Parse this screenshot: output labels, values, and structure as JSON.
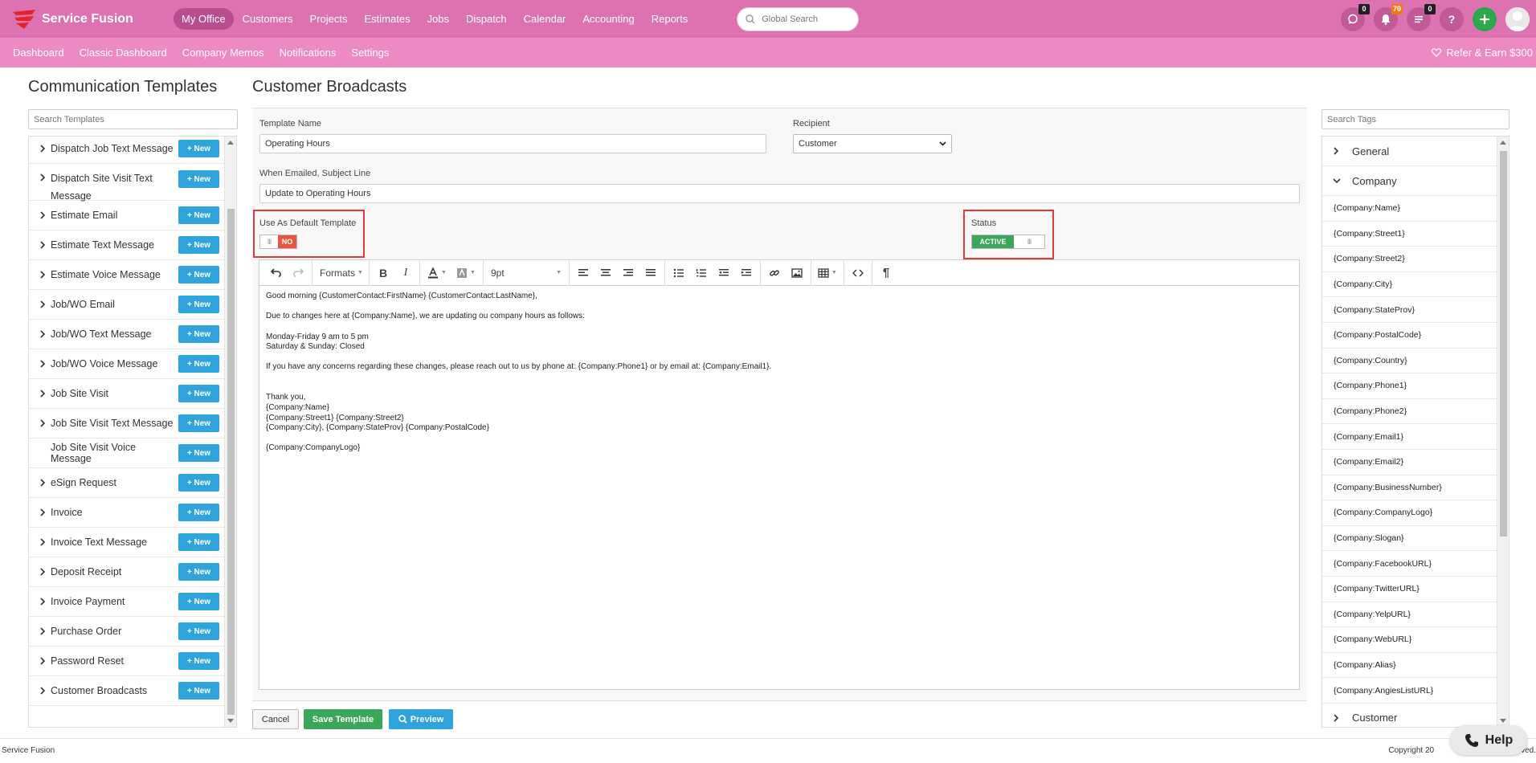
{
  "app": {
    "name": "Service Fusion",
    "brand_color": "#dc73b0",
    "subnav_color": "#ee8ac3"
  },
  "topnav": {
    "items": [
      "My Office",
      "Customers",
      "Projects",
      "Estimates",
      "Jobs",
      "Dispatch",
      "Calendar",
      "Accounting",
      "Reports"
    ],
    "active": "My Office",
    "search_placeholder": "Global Search",
    "badges": {
      "chat": "0",
      "notifications": "70",
      "tasks": "0"
    },
    "icons": [
      "chat-icon",
      "bell-icon",
      "list-icon",
      "help-icon",
      "plus-icon",
      "avatar"
    ]
  },
  "subnav": {
    "items": [
      "Dashboard",
      "Classic Dashboard",
      "Company Memos",
      "Notifications",
      "Settings"
    ],
    "refer": "Refer & Earn $300"
  },
  "left": {
    "title": "Communication Templates",
    "search_placeholder": "Search Templates",
    "new_label": "+ New",
    "items": [
      "Dispatch Job Text Message",
      "Dispatch Site Visit Text Message",
      "Estimate Email",
      "Estimate Text Message",
      "Estimate Voice Message",
      "Job/WO Email",
      "Job/WO Text Message",
      "Job/WO Voice Message",
      "Job Site Visit",
      "Job Site Visit Text Message",
      "Job Site Visit Voice Message",
      "eSign Request",
      "Invoice",
      "Invoice Text Message",
      "Deposit Receipt",
      "Invoice Payment",
      "Purchase Order",
      "Password Reset",
      "Customer Broadcasts"
    ]
  },
  "form": {
    "title": "Customer Broadcasts",
    "template_name_label": "Template Name",
    "template_name_value": "Operating Hours",
    "recipient_label": "Recipient",
    "recipient_value": "Customer",
    "subject_label": "When Emailed, Subject Line",
    "subject_value": "Update to Operating Hours",
    "default_label": "Use As Default Template",
    "default_value": "NO",
    "status_label": "Status",
    "status_value": "ACTIVE",
    "grip": "III"
  },
  "editor": {
    "formats_label": "Formats",
    "font_size": "9pt",
    "body": {
      "line1": "Good morning {CustomerContact:FirstName} {CustomerContact:LastName},",
      "line2": "Due to changes here at {Company:Name}, we are updating ou company hours as follows:",
      "line3": "Monday-Friday 9 am to 5 pm",
      "line4": "Saturday & Sunday: Closed",
      "line5": "If you have any concerns regarding these changes, please reach out to us by phone at: {Company:Phone1} or by email at: {Company:Email1}.",
      "line6": "Thank you,",
      "line7": "{Company:Name}",
      "line8": "{Company:Street1} {Company:Street2}",
      "line9": "{Company:City}, {Company:StateProv} {Company:PostalCode}",
      "line10": "{Company:CompanyLogo}"
    }
  },
  "buttons": {
    "cancel": "Cancel",
    "save": "Save Template",
    "preview": "Preview"
  },
  "tags": {
    "search_placeholder": "Search Tags",
    "group_general": "General",
    "group_company": "Company",
    "group_customer": "Customer",
    "company_items": [
      "{Company:Name}",
      "{Company:Street1}",
      "{Company:Street2}",
      "{Company:City}",
      "{Company:StateProv}",
      "{Company:PostalCode}",
      "{Company:Country}",
      "{Company:Phone1}",
      "{Company:Phone2}",
      "{Company:Email1}",
      "{Company:Email2}",
      "{Company:BusinessNumber}",
      "{Company:CompanyLogo}",
      "{Company:Slogan}",
      "{Company:FacebookURL}",
      "{Company:TwitterURL}",
      "{Company:YelpURL}",
      "{Company:WebURL}",
      "{Company:Alias}",
      "{Company:AngiesListURL}"
    ]
  },
  "footer": {
    "left": "Service Fusion",
    "right": "Copyright 20",
    "right_tail": "ved.",
    "help": "Help"
  }
}
